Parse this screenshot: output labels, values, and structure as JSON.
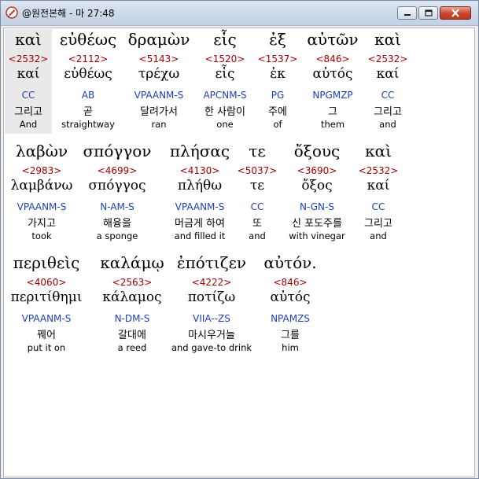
{
  "window": {
    "title": "@원전본해 - 마 27:48"
  },
  "rows": [
    {
      "words": [
        {
          "greek": "καὶ",
          "strong": "<2532>",
          "lemma": "καί",
          "morph": "CC",
          "korean": "그리고",
          "english": "And"
        },
        {
          "greek": "εὐθέως",
          "strong": "<2112>",
          "lemma": "εὐθέως",
          "morph": "AB",
          "korean": "곧",
          "english": "straightway"
        },
        {
          "greek": "δραμὼν",
          "strong": "<5143>",
          "lemma": "τρέχω",
          "morph": "VPAANM-S",
          "korean": "달려가서",
          "english": "ran"
        },
        {
          "greek": "εἷς",
          "strong": "<1520>",
          "lemma": "εἷς",
          "morph": "APCNM-S",
          "korean": "한 사람이",
          "english": "one"
        },
        {
          "greek": "ἐξ",
          "strong": "<1537>",
          "lemma": "ἐκ",
          "morph": "PG",
          "korean": "주에",
          "english": "of"
        },
        {
          "greek": "αὐτῶν",
          "strong": "<846>",
          "lemma": "αὐτός",
          "morph": "NPGMZP",
          "korean": "그",
          "english": "them"
        },
        {
          "greek": "καὶ",
          "strong": "<2532>",
          "lemma": "καί",
          "morph": "CC",
          "korean": "그리고",
          "english": "and"
        }
      ]
    },
    {
      "words": [
        {
          "greek": "λαβὼν",
          "strong": "<2983>",
          "lemma": "λαμβάνω",
          "morph": "VPAANM-S",
          "korean": "가지고",
          "english": "took"
        },
        {
          "greek": "σπόγγον",
          "strong": "<4699>",
          "lemma": "σπόγγος",
          "morph": "N-AM-S",
          "korean": "해융을",
          "english": "a sponge"
        },
        {
          "greek": "πλήσας",
          "strong": "<4130>",
          "lemma": "πλήθω",
          "morph": "VPAANM-S",
          "korean": "머금게 하여",
          "english": "and filled it"
        },
        {
          "greek": "τε",
          "strong": "<5037>",
          "lemma": "τε",
          "morph": "CC",
          "korean": "또",
          "english": "and"
        },
        {
          "greek": "ὄξους",
          "strong": "<3690>",
          "lemma": "ὄξος",
          "morph": "N-GN-S",
          "korean": "신 포도주를",
          "english": "with vinegar"
        },
        {
          "greek": "καὶ",
          "strong": "<2532>",
          "lemma": "καί",
          "morph": "CC",
          "korean": "그리고",
          "english": "and"
        }
      ]
    },
    {
      "words": [
        {
          "greek": "περιθεὶς",
          "strong": "<4060>",
          "lemma": "περιτίθημι",
          "morph": "VPAANM-S",
          "korean": "꿰어",
          "english": "put it on"
        },
        {
          "greek": "καλάμῳ",
          "strong": "<2563>",
          "lemma": "κάλαμος",
          "morph": "N-DM-S",
          "korean": "갈대에",
          "english": "a reed"
        },
        {
          "greek": "ἐπότιζεν",
          "strong": "<4222>",
          "lemma": "ποτίζω",
          "morph": "VIIA--ZS",
          "korean": "마시우거늘",
          "english": "and gave-to drink"
        },
        {
          "greek": "αὐτόν.",
          "strong": "<846>",
          "lemma": "αὐτός",
          "morph": "NPAMZS",
          "korean": "그를",
          "english": "him"
        }
      ]
    }
  ]
}
